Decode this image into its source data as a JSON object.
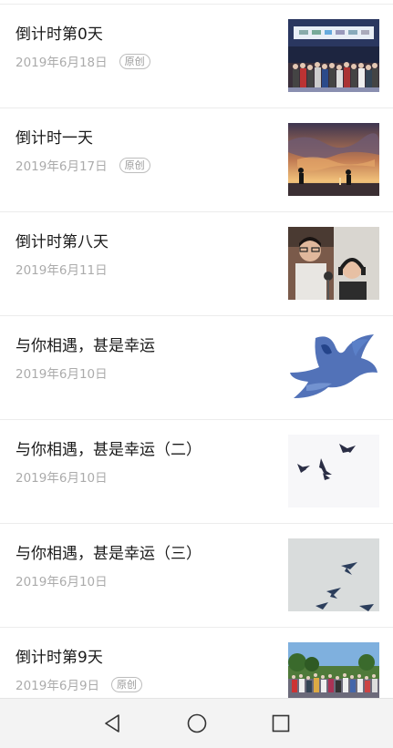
{
  "articles": [
    {
      "title": "倒计时第0天",
      "date": "2019年6月18日",
      "badge": "原创",
      "thumb_icon": "group-photo-stage-thumbnail"
    },
    {
      "title": "倒计时一天",
      "date": "2019年6月17日",
      "badge": "原创",
      "thumb_icon": "sunset-sky-illustration-thumbnail"
    },
    {
      "title": "倒计时第八天",
      "date": "2019年6月11日",
      "badge": "",
      "thumb_icon": "recording-studio-photo-thumbnail"
    },
    {
      "title": "与你相遇，甚是幸运",
      "date": "2019年6月10日",
      "badge": "",
      "thumb_icon": "watercolor-bird-thumbnail"
    },
    {
      "title": "与你相遇，甚是幸运（二）",
      "date": "2019年6月10日",
      "badge": "",
      "thumb_icon": "swallows-flying-thumbnail"
    },
    {
      "title": "与你相遇，甚是幸运（三）",
      "date": "2019年6月10日",
      "badge": "",
      "thumb_icon": "birds-grey-sky-thumbnail"
    },
    {
      "title": "倒计时第9天",
      "date": "2019年6月9日",
      "badge": "原创",
      "thumb_icon": "campus-crowd-photo-thumbnail"
    }
  ],
  "navbar": {
    "back_icon": "back-triangle-icon",
    "home_icon": "home-circle-icon",
    "recents_icon": "recents-square-icon"
  }
}
